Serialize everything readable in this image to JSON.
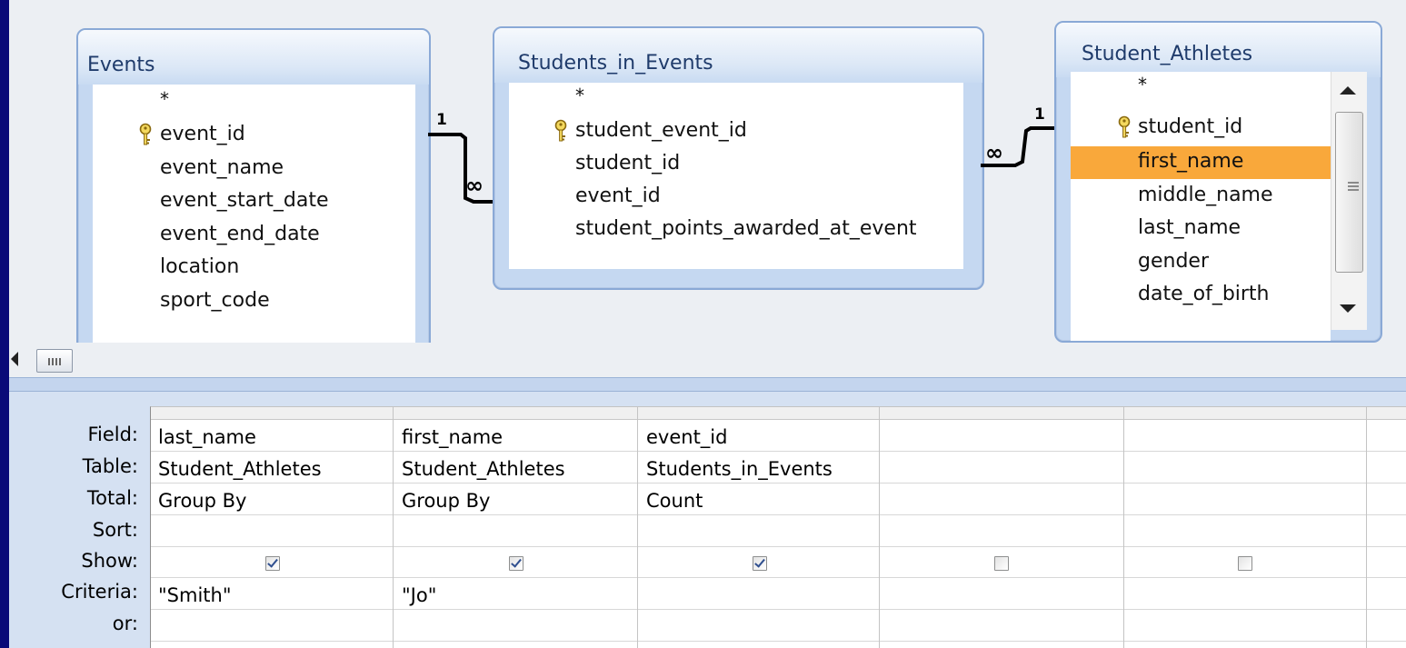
{
  "tables": {
    "events": {
      "title": "Events",
      "fields": [
        "*",
        "event_id",
        "event_name",
        "event_start_date",
        "event_end_date",
        "location",
        "sport_code"
      ],
      "primary_key": "event_id"
    },
    "students_in_events": {
      "title": "Students_in_Events",
      "fields": [
        "*",
        "student_event_id",
        "student_id",
        "event_id",
        "student_points_awarded_at_event"
      ],
      "primary_key": "student_event_id"
    },
    "student_athletes": {
      "title": "Student_Athletes",
      "fields": [
        "*",
        "student_id",
        "first_name",
        "middle_name",
        "last_name",
        "gender",
        "date_of_birth"
      ],
      "primary_key": "student_id",
      "selected_field": "first_name"
    }
  },
  "relationships": [
    {
      "from": "Events.event_id",
      "to": "Students_in_Events.event_id",
      "one_label": "1",
      "many_label": "∞"
    },
    {
      "from": "Student_Athletes.student_id",
      "to": "Students_in_Events.student_id",
      "one_label": "1",
      "many_label": "∞"
    }
  ],
  "grid": {
    "row_labels": [
      "Field:",
      "Table:",
      "Total:",
      "Sort:",
      "Show:",
      "Criteria:",
      "or:"
    ],
    "columns": [
      {
        "field": "last_name",
        "table": "Student_Athletes",
        "total": "Group By",
        "sort": "",
        "show": true,
        "criteria": "\"Smith\"",
        "or": ""
      },
      {
        "field": "first_name",
        "table": "Student_Athletes",
        "total": "Group By",
        "sort": "",
        "show": true,
        "criteria": "\"Jo\"",
        "or": ""
      },
      {
        "field": "event_id",
        "table": "Students_in_Events",
        "total": "Count",
        "sort": "",
        "show": true,
        "criteria": "",
        "or": ""
      },
      {
        "field": "",
        "table": "",
        "total": "",
        "sort": "",
        "show": false,
        "criteria": "",
        "or": ""
      },
      {
        "field": "",
        "table": "",
        "total": "",
        "sort": "",
        "show": false,
        "criteria": "",
        "or": ""
      }
    ]
  },
  "colors": {
    "background": "#0a0a78",
    "selection": "#f9a83b",
    "table_border": "#8aa9d6",
    "grid_pane": "#d5e1f2"
  },
  "icons": {
    "key": "key-icon",
    "scroll_left": "scroll-left-icon",
    "scroll_up": "scroll-up-icon",
    "scroll_down": "scroll-down-icon"
  }
}
